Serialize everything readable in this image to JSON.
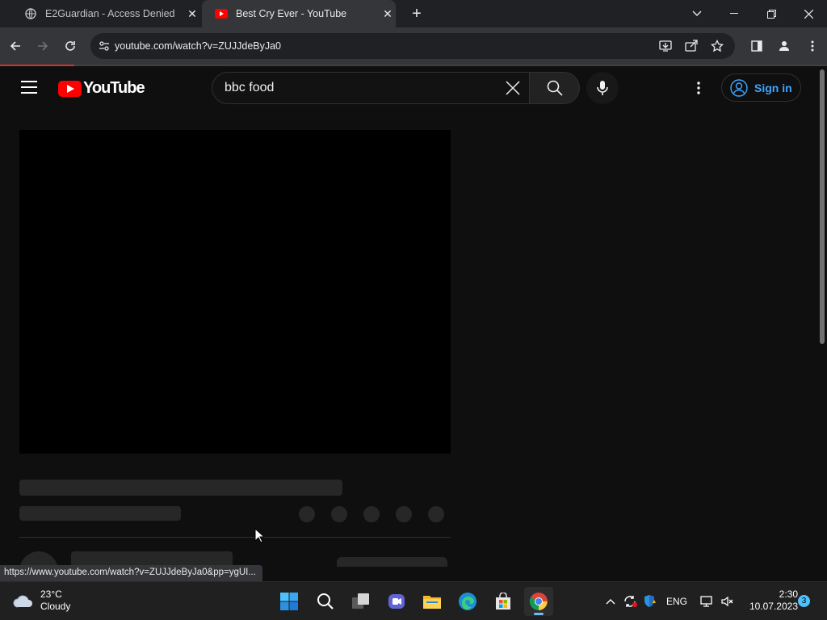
{
  "browser": {
    "tabs": [
      {
        "title": "E2Guardian - Access Denied",
        "favicon": "globe-icon",
        "active": false
      },
      {
        "title": "Best Cry Ever - YouTube",
        "favicon": "youtube-icon",
        "active": true
      }
    ],
    "url": "youtube.com/watch?v=ZUJJdeByJa0",
    "status_url": "https://www.youtube.com/watch?v=ZUJJdeByJa0&pp=ygUI..."
  },
  "youtube": {
    "brand": "YouTube",
    "search_value": "bbc food",
    "signin_label": "Sign in"
  },
  "taskbar": {
    "weather_temp": "23°C",
    "weather_desc": "Cloudy",
    "language": "ENG",
    "time": "2:30",
    "date": "10.07.2023",
    "notification_count": "3"
  },
  "colors": {
    "yt_red": "#ff0000",
    "signin_blue": "#3ea6ff",
    "load_red": "#d93025"
  }
}
